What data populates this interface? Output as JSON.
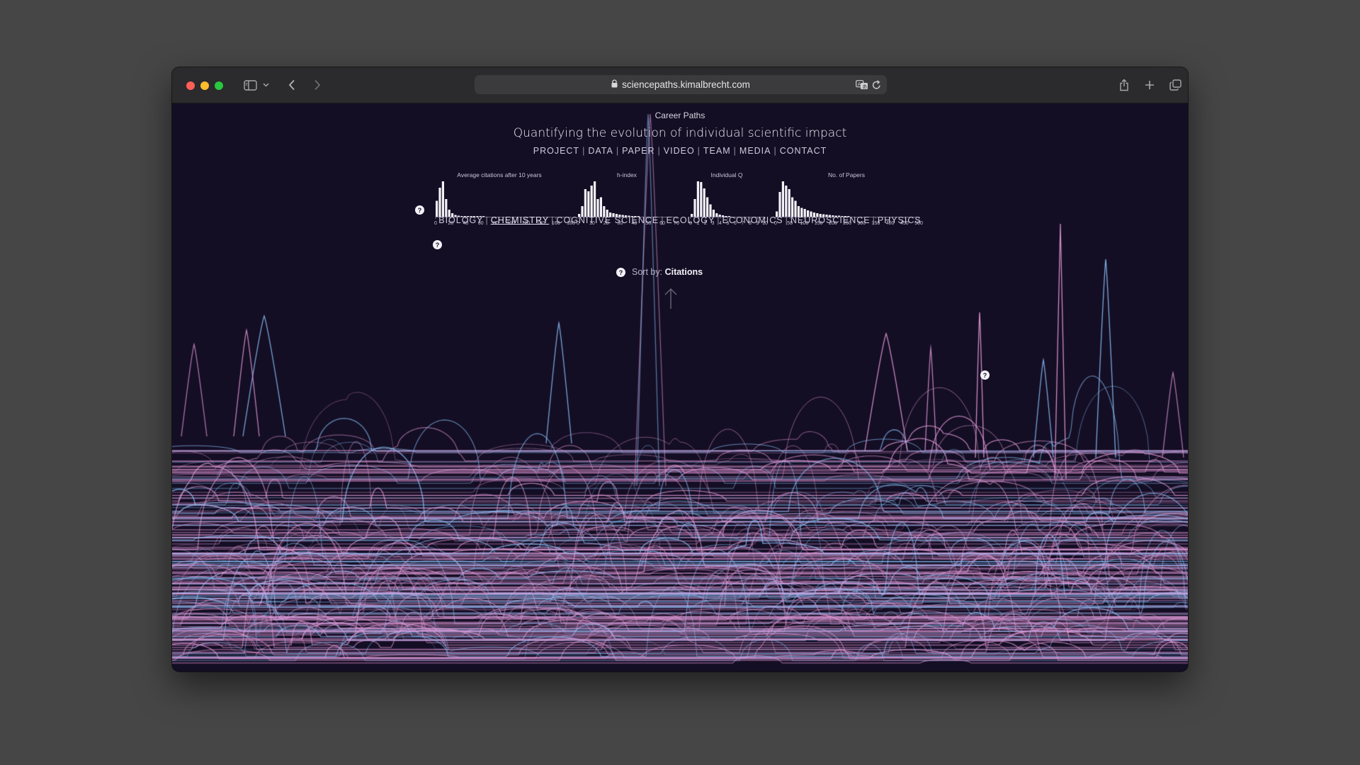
{
  "browser": {
    "url": "sciencepaths.kimalbrecht.com",
    "traffic_colors": [
      "#ff5f57",
      "#febc2e",
      "#28c840"
    ]
  },
  "site": {
    "kicker": "Career Paths",
    "title": "Quantifying the evolution of individual scientific impact",
    "nav": [
      "PROJECT",
      "DATA",
      "PAPER",
      "VIDEO",
      "TEAM",
      "MEDIA",
      "CONTACT"
    ],
    "fields": [
      "BIOLOGY",
      "CHEMISTRY",
      "COGNITIVE SCIENCE",
      "ECOLOGY",
      "ECONOMICS",
      "NEUROSCIENCE",
      "PHYSICS"
    ],
    "active_field": "CHEMISTRY",
    "sort_label": "Sort by:",
    "sort_value": "Citations",
    "help_glyph": "?"
  },
  "colors": {
    "background": "#140e24",
    "pink": "#e29ad8",
    "blue": "#8cc6ff",
    "bar": "#f4f2f8"
  },
  "chart_data": [
    {
      "type": "bar",
      "title": "Average citations after 10 years",
      "tick_labels": [
        "0",
        "20",
        "40",
        "60",
        "80",
        "100",
        "120",
        "140",
        "160",
        "180"
      ],
      "values": [
        0.45,
        0.82,
        1.0,
        0.5,
        0.2,
        0.1,
        0.05,
        0.03,
        0.02,
        0.02,
        0.01,
        0.01,
        0.01,
        0.01,
        0.01,
        0.01
      ]
    },
    {
      "type": "bar",
      "title": "h-index",
      "tick_labels": [
        "0",
        "10",
        "20",
        "30",
        "40",
        "50",
        "60",
        "70"
      ],
      "values": [
        0.08,
        0.3,
        0.78,
        0.72,
        0.88,
        1.0,
        0.5,
        0.55,
        0.3,
        0.2,
        0.12,
        0.1,
        0.08,
        0.06,
        0.05,
        0.04,
        0.03,
        0.02,
        0.02,
        0.01
      ]
    },
    {
      "type": "bar",
      "title": "Individual Q",
      "tick_labels": [
        "0",
        "1",
        "2",
        "3",
        "4",
        "5",
        "6",
        "7",
        "8",
        "9",
        "10"
      ],
      "values": [
        0.08,
        0.5,
        1.0,
        0.98,
        0.8,
        0.55,
        0.35,
        0.2,
        0.1,
        0.06,
        0.04,
        0.02,
        0.01
      ]
    },
    {
      "type": "bar",
      "title": "No. of Papers",
      "tick_labels": [
        "0",
        "50",
        "100",
        "150",
        "200",
        "250",
        "300",
        "350",
        "400",
        "450",
        "500"
      ],
      "values": [
        0.15,
        0.7,
        1.0,
        0.88,
        0.78,
        0.55,
        0.45,
        0.3,
        0.25,
        0.22,
        0.18,
        0.15,
        0.12,
        0.1,
        0.08,
        0.07,
        0.06,
        0.05,
        0.04,
        0.03,
        0.03,
        0.02,
        0.02,
        0.01
      ]
    }
  ]
}
